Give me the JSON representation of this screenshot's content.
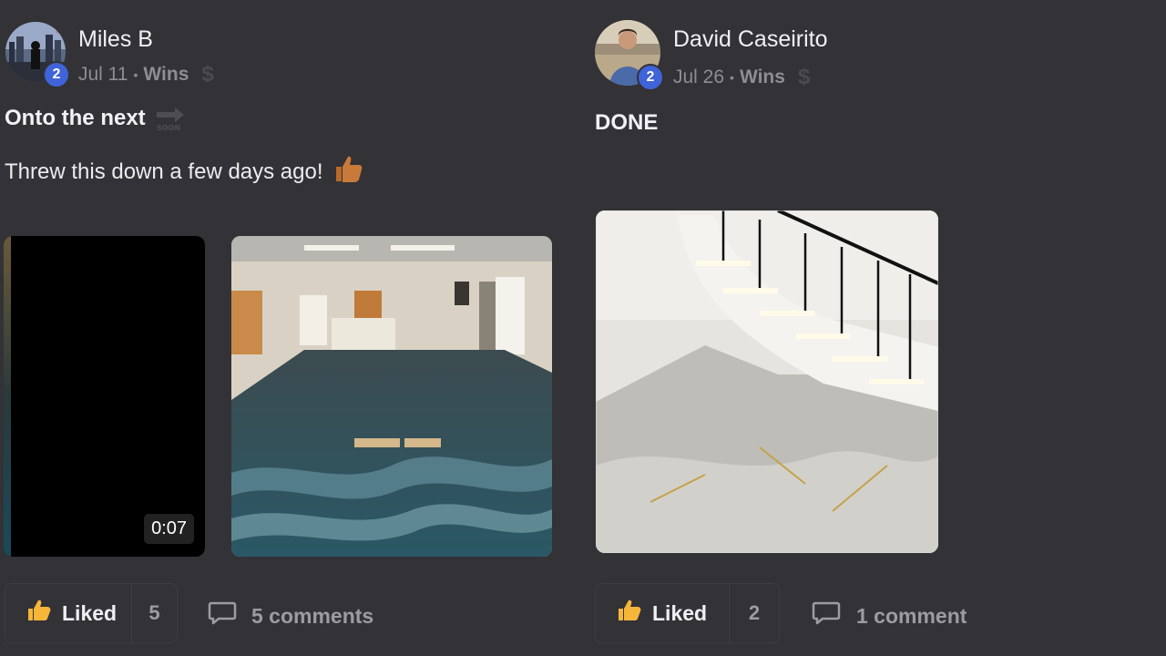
{
  "posts": [
    {
      "author": "Miles B",
      "level": "2",
      "date": "Jul 11",
      "separator": "•",
      "category": "Wins",
      "title": "Onto the next",
      "body": "Threw this down a few days ago!",
      "video_duration": "0:07",
      "like_label": "Liked",
      "like_count": "5",
      "comments_label": "5 comments"
    },
    {
      "author": "David Caseirito",
      "level": "2",
      "date": "Jul 26",
      "separator": "•",
      "category": "Wins",
      "title": "DONE",
      "like_label": "Liked",
      "like_count": "2",
      "comments_label": "1 comment"
    }
  ],
  "icons": {
    "dollar": "$",
    "thumb": "thumbs-up-icon",
    "comment": "comment-bubble-icon",
    "soon": "soon-arrow-icon"
  },
  "colors": {
    "background": "#333236",
    "badge": "#3f63d8",
    "like_icon": "#f5b63a"
  }
}
